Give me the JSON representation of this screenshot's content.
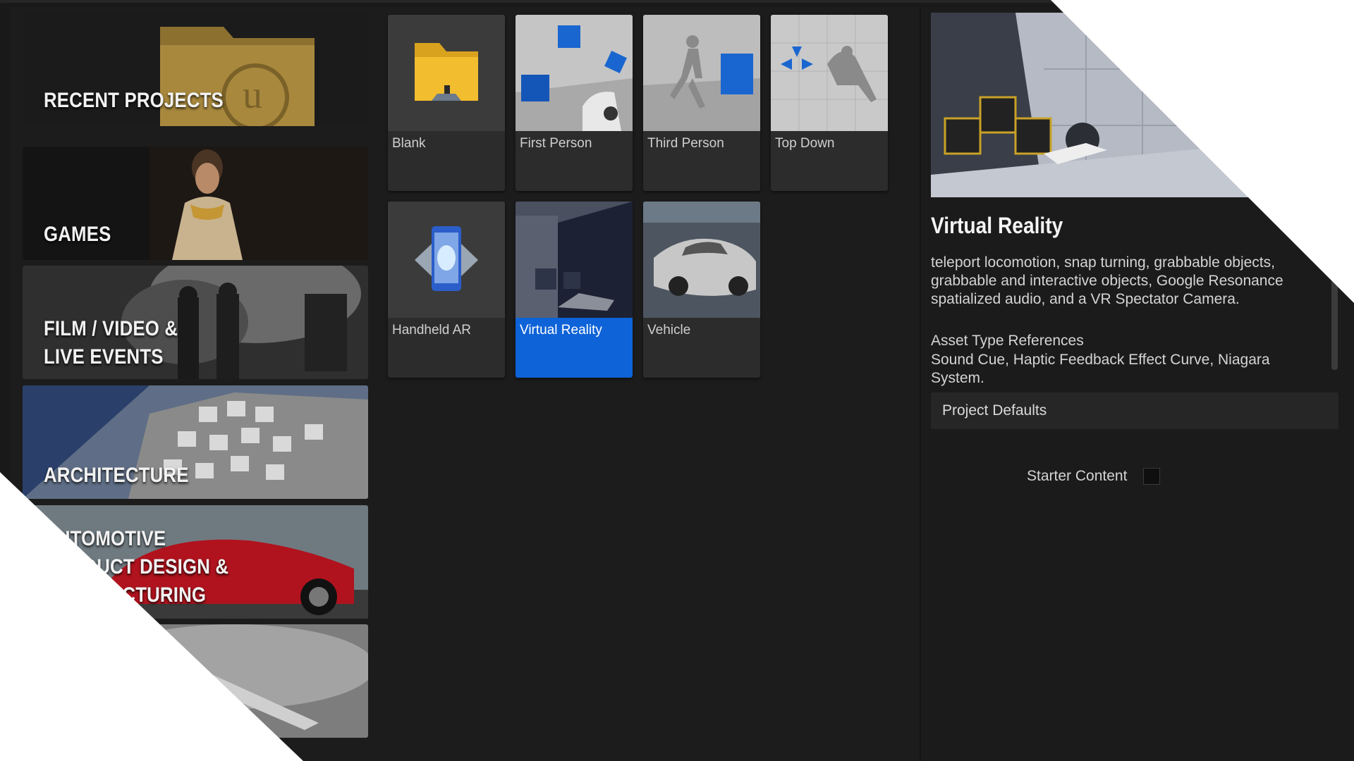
{
  "categories": [
    {
      "label": "RECENT PROJECTS",
      "selected": false
    },
    {
      "label": "GAMES",
      "selected": true
    },
    {
      "label": "FILM / VIDEO &\nLIVE EVENTS",
      "selected": false
    },
    {
      "label": "ARCHITECTURE",
      "selected": false
    },
    {
      "label": "AUTOMOTIVE\nPRODUCT DESIGN &\nMANUFACTURING",
      "selected": false
    },
    {
      "label": "",
      "selected": false
    }
  ],
  "templates": [
    {
      "label": "Blank",
      "icon": "folder-icon",
      "selected": false
    },
    {
      "label": "First Person",
      "icon": "first-person-scene",
      "selected": false
    },
    {
      "label": "Third Person",
      "icon": "mannequin-scene",
      "selected": false
    },
    {
      "label": "Top Down",
      "icon": "top-down-scene",
      "selected": false
    },
    {
      "label": "Handheld AR",
      "icon": "phone-ar-icon",
      "selected": false
    },
    {
      "label": "Virtual Reality",
      "icon": "vr-scene",
      "selected": true
    },
    {
      "label": "Vehicle",
      "icon": "car-scene",
      "selected": false
    }
  ],
  "details": {
    "title": "Virtual Reality",
    "description": "teleport locomotion, snap turning, grabbable objects, grabbable and interactive objects, Google Resonance spatialized audio, and a VR Spectator Camera.",
    "asset_header": "Asset Type References",
    "asset_values": "Sound Cue, Haptic Feedback Effect Curve, Niagara System.",
    "project_defaults": "Project Defaults",
    "starter_content": "Starter Content",
    "starter_checked": false
  },
  "colors": {
    "accent": "#0e63d8",
    "background": "#191919",
    "tile": "#2c2c2c"
  }
}
